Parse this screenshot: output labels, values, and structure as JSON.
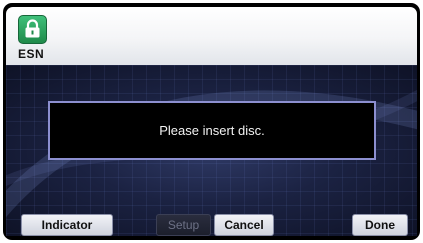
{
  "header": {
    "app_label": "ESN",
    "icon": "lock-icon"
  },
  "dialog": {
    "message": "Please insert disc."
  },
  "buttons": {
    "indicator": "Indicator",
    "setup": "Setup",
    "cancel": "Cancel",
    "done": "Done"
  },
  "colors": {
    "icon_green": "#2ea35e",
    "dialog_border": "#8c8fd0",
    "background": "#1b2242"
  }
}
